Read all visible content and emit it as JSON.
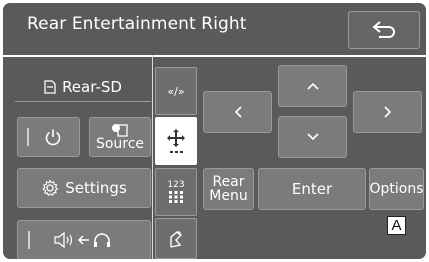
{
  "header": {
    "title": "Rear Entertainment Right",
    "back_icon": "return-arrow-icon"
  },
  "source": {
    "media_label": "Rear-SD",
    "media_icon": "sd-card-icon"
  },
  "left_panel": {
    "power_icon": "power-icon",
    "source_label": "Source",
    "settings_label": "Settings",
    "audio_icon": "speaker-to-headphones-icon"
  },
  "tabs": [
    {
      "text": "«/»",
      "icon": "skip-tab"
    },
    {
      "text": "",
      "icon": "cursor-move-icon",
      "active": true
    },
    {
      "text": "123",
      "icon": "number-keypad-icon"
    },
    {
      "text": "",
      "icon": "touch-gesture-icon"
    }
  ],
  "dpad": {
    "up": "up-arrow-icon",
    "down": "down-arrow-icon",
    "left": "left-arrow-icon",
    "right": "right-arrow-icon"
  },
  "bottom_row": {
    "rear_menu_line1": "Rear",
    "rear_menu_line2": "Menu",
    "enter_label": "Enter",
    "options_label": "Options"
  },
  "callout": "A"
}
